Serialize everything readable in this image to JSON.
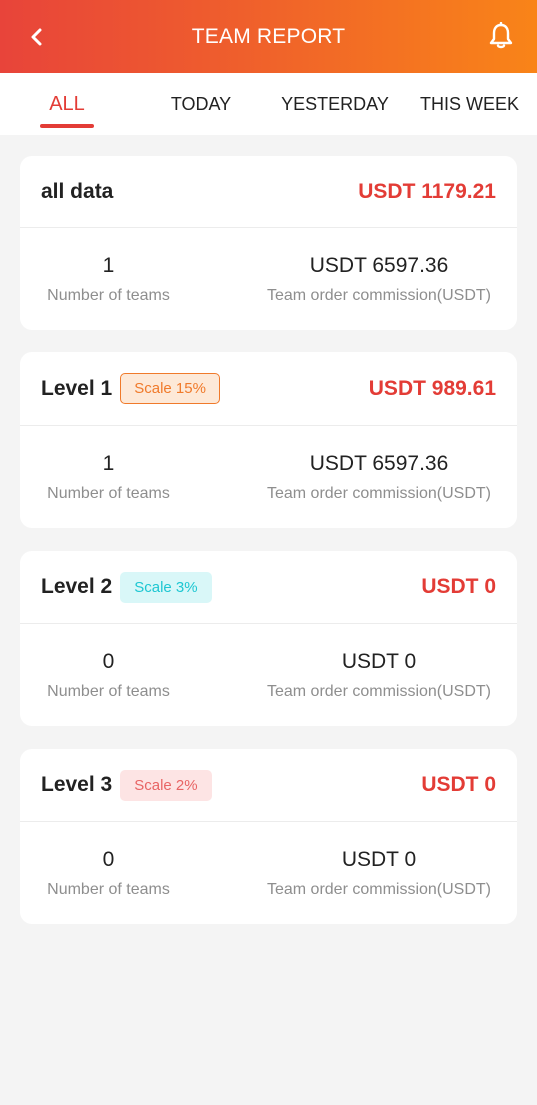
{
  "header": {
    "title": "TEAM REPORT",
    "back_icon": "chevron-left-icon",
    "bell_icon": "bell-icon"
  },
  "tabs": [
    {
      "label": "ALL",
      "active": true
    },
    {
      "label": "TODAY",
      "active": false
    },
    {
      "label": "YESTERDAY",
      "active": false
    },
    {
      "label": "THIS WEEK",
      "active": false
    }
  ],
  "cards": [
    {
      "name": "all data",
      "badge": "",
      "amount": "USDT 1179.21",
      "teams_value": "1",
      "teams_label": "Number of teams",
      "commission_value": "USDT 6597.36",
      "commission_label": "Team order commission(USDT)"
    },
    {
      "name": "Level 1",
      "badge": "Scale 15%",
      "amount": "USDT 989.61",
      "teams_value": "1",
      "teams_label": "Number of teams",
      "commission_value": "USDT 6597.36",
      "commission_label": "Team order commission(USDT)"
    },
    {
      "name": "Level 2",
      "badge": "Scale 3%",
      "amount": "USDT 0",
      "teams_value": "0",
      "teams_label": "Number of teams",
      "commission_value": "USDT 0",
      "commission_label": "Team order commission(USDT)"
    },
    {
      "name": "Level 3",
      "badge": "Scale 2%",
      "amount": "USDT 0",
      "teams_value": "0",
      "teams_label": "Number of teams",
      "commission_value": "USDT 0",
      "commission_label": "Team order commission(USDT)"
    }
  ],
  "colors": {
    "accent": "#e33c36",
    "header_gradient_start": "#e8443a",
    "header_gradient_end": "#f98418",
    "badge_level1": "#f07a2b",
    "badge_level2": "#1ec7d2",
    "badge_level3": "#e86464"
  }
}
